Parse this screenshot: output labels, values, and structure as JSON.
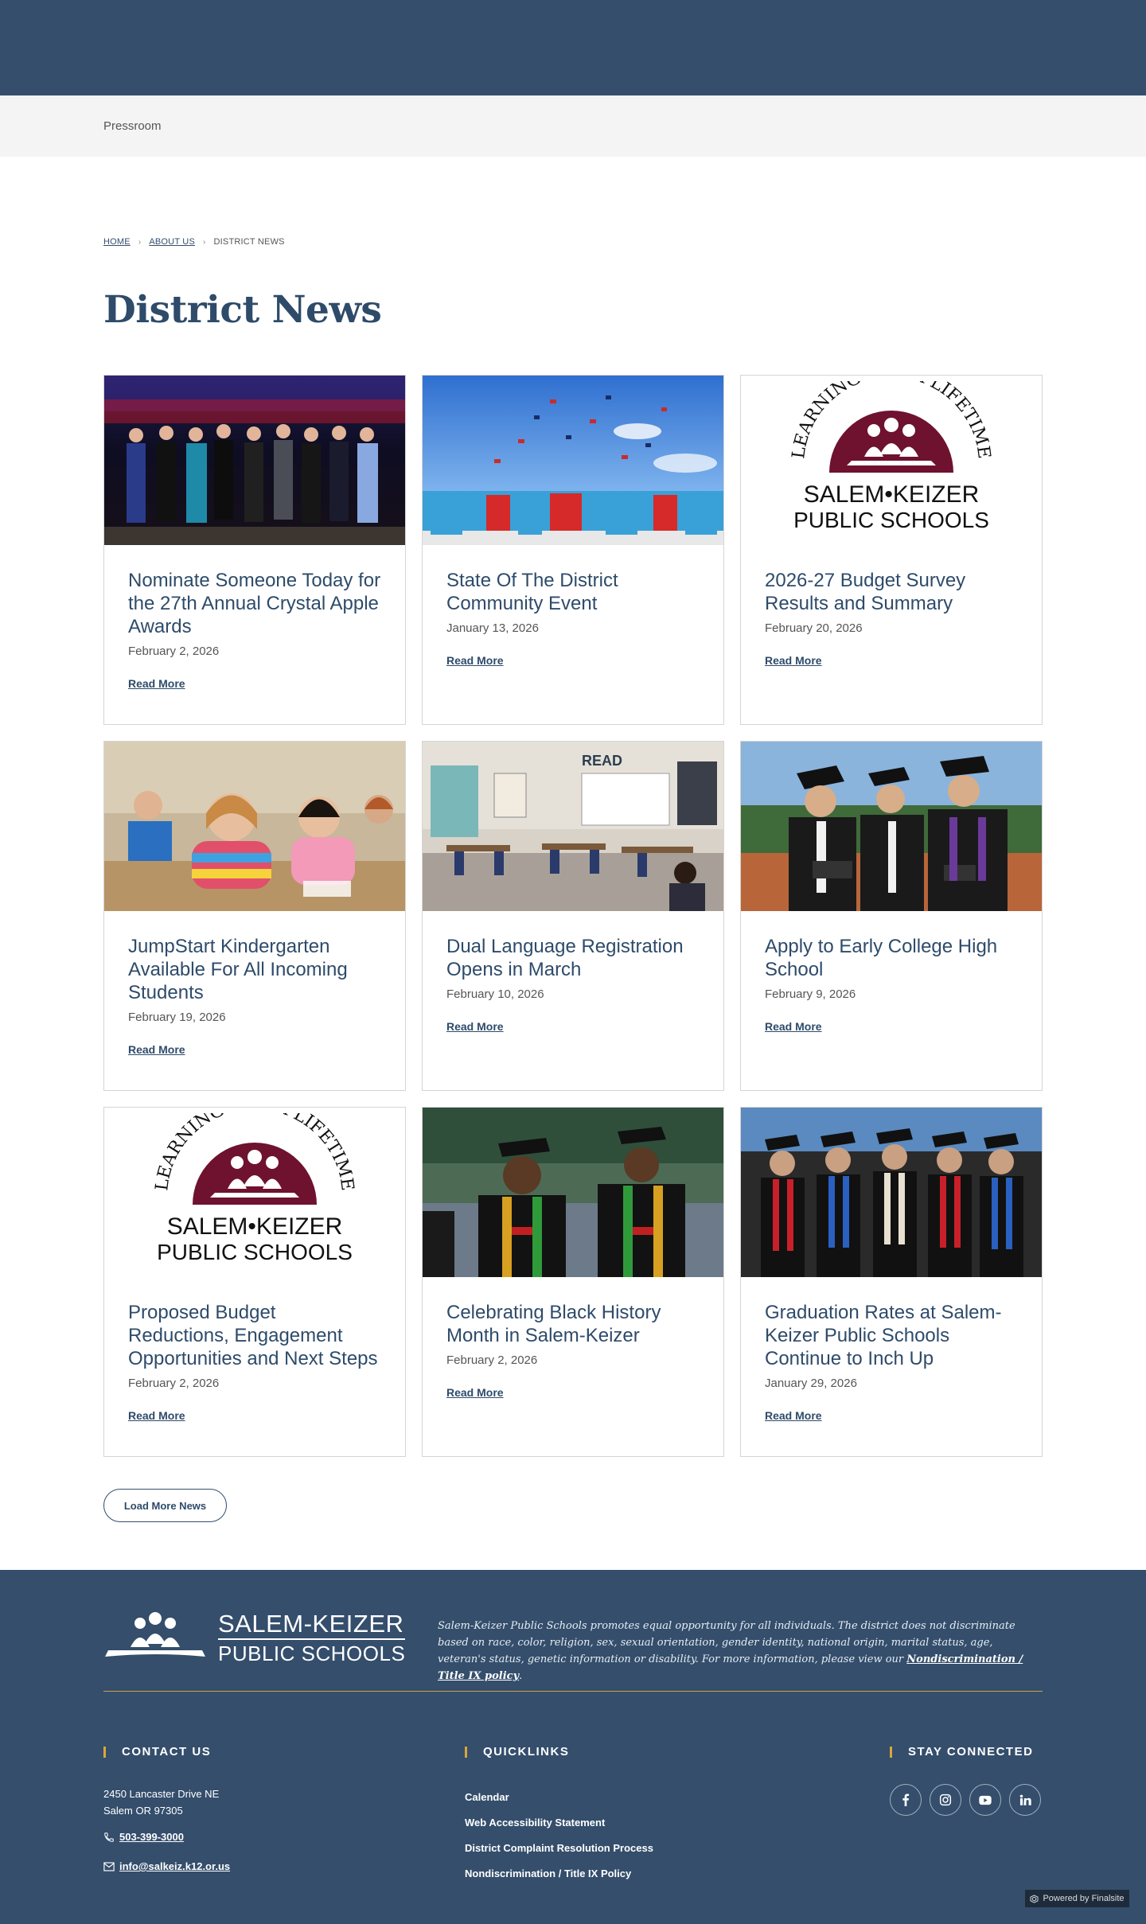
{
  "subnav": {
    "label": "Pressroom"
  },
  "breadcrumb": {
    "home": "HOME",
    "about": "ABOUT US",
    "current": "DISTRICT NEWS"
  },
  "page": {
    "title": "District News"
  },
  "logo_words": {
    "arc": "LEARNING FOR A LIFETIME",
    "line1": "SALEM•KEIZER",
    "line2": "PUBLIC SCHOOLS"
  },
  "news": [
    {
      "title": "Nominate Someone Today for the 27th Annual Crystal Apple Awards",
      "date": "February 2, 2026",
      "link": "Read More",
      "image": "crystal-apple-group-photo"
    },
    {
      "title": "State Of The District Community Event",
      "date": "January 13, 2026",
      "link": "Read More",
      "image": "graduation-caps-in-air-photo"
    },
    {
      "title": "2026-27 Budget Survey Results and Summary",
      "date": "February 20, 2026",
      "link": "Read More",
      "image": "salem-keizer-logo"
    },
    {
      "title": "JumpStart Kindergarten Available For All Incoming Students",
      "date": "February 19, 2026",
      "link": "Read More",
      "image": "kindergarten-students-photo"
    },
    {
      "title": "Dual Language Registration Opens in March",
      "date": "February 10, 2026",
      "link": "Read More",
      "image": "classroom-photo"
    },
    {
      "title": "Apply to Early College High School",
      "date": "February 9, 2026",
      "link": "Read More",
      "image": "graduates-diplomas-photo"
    },
    {
      "title": "Proposed Budget Reductions, Engagement Opportunities and Next Steps",
      "date": "February 2, 2026",
      "link": "Read More",
      "image": "salem-keizer-logo"
    },
    {
      "title": "Celebrating Black History Month in Salem-Keizer",
      "date": "February 2, 2026",
      "link": "Read More",
      "image": "graduates-kente-stoles-photo"
    },
    {
      "title": "Graduation Rates at Salem-Keizer Public Schools Continue to Inch Up",
      "date": "January 29, 2026",
      "link": "Read More",
      "image": "graduating-class-group-photo"
    }
  ],
  "load_more": {
    "label": "Load More News"
  },
  "footer": {
    "logo_line1": "SALEM-KEIZER",
    "logo_line2": "PUBLIC SCHOOLS",
    "statement": "Salem-Keizer Public Schools promotes equal opportunity for all individuals. The district does not discriminate based on race, color, religion, sex, sexual orientation, gender identity, national origin, marital status, age, veteran's status, genetic information or disability. For more information, please view our ",
    "statement_link": "Nondiscrimination / Title IX policy",
    "statement_end": ".",
    "contact": {
      "heading": "CONTACT US",
      "address1": "2450 Lancaster Drive NE",
      "address2": "Salem OR  97305",
      "phone": "503-399-3000",
      "email": "info@salkeiz.k12.or.us"
    },
    "quicklinks": {
      "heading": "QUICKLINKS",
      "items": [
        "Calendar",
        "Web Accessibility Statement",
        "District Complaint Resolution Process",
        "Nondiscrimination / Title IX Policy"
      ]
    },
    "social": {
      "heading": "STAY CONNECTED",
      "icons": [
        "facebook-icon",
        "instagram-icon",
        "youtube-icon",
        "linkedin-icon"
      ]
    },
    "powered_by": "Powered by Finalsite"
  },
  "colors": {
    "navy": "#344e6c",
    "title_navy": "#2e4b6a",
    "gold_accent": "#d8a63a",
    "logo_maroon": "#6e1230"
  }
}
